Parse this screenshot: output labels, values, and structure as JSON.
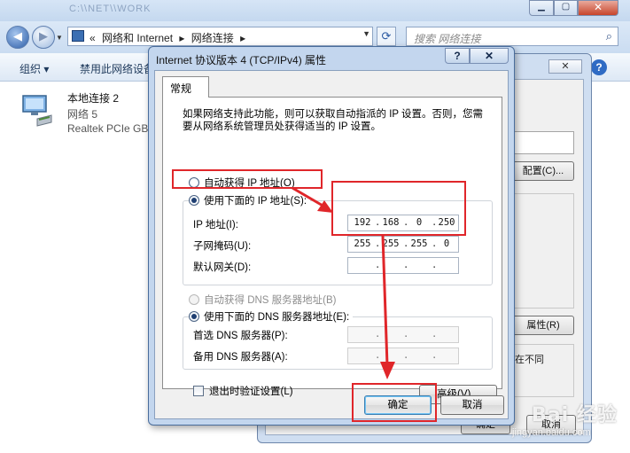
{
  "explorer": {
    "blurred_title": "C:\\\\NET\\\\WORK",
    "address": {
      "prefix": "«",
      "crumbs": [
        "网络和 Internet",
        "网络连接"
      ],
      "separator": "▸"
    },
    "search_placeholder": "搜索 网络连接",
    "commands": {
      "organize": "组织 ▾",
      "disable": "禁用此网络设备"
    },
    "connection": {
      "name": "本地连接 2",
      "network": "网络  5",
      "device": "Realtek PCIe GBE"
    }
  },
  "prop_dialog": {
    "configure_btn": "配置(C)...",
    "properties_btn": "属性(R)",
    "desc_tail": "在不同",
    "ok": "确定",
    "cancel": "取消"
  },
  "dialog": {
    "title": "Internet 协议版本 4 (TCP/IPv4) 属性",
    "help": "?",
    "close": "✕",
    "tab": "常规",
    "description": "如果网络支持此功能，则可以获取自动指派的 IP 设置。否则，您需要从网络系统管理员处获得适当的 IP 设置。",
    "ip_section": {
      "auto_label": "自动获得 IP 地址(O)",
      "auto_selected": false,
      "manual_label": "使用下面的 IP 地址(S):",
      "manual_selected": true,
      "ip_label": "IP 地址(I):",
      "ip": [
        "192",
        "168",
        "0",
        "250"
      ],
      "mask_label": "子网掩码(U):",
      "mask": [
        "255",
        "255",
        "255",
        "0"
      ],
      "gateway_label": "默认网关(D):",
      "gateway": [
        "",
        "",
        "",
        ""
      ]
    },
    "dns_section": {
      "auto_label": "自动获得 DNS 服务器地址(B)",
      "auto_selected": false,
      "manual_label": "使用下面的 DNS 服务器地址(E):",
      "manual_selected": true,
      "preferred_label": "首选 DNS 服务器(P):",
      "preferred": [
        "",
        "",
        "",
        ""
      ],
      "alternate_label": "备用 DNS 服务器(A):",
      "alternate": [
        "",
        "",
        "",
        ""
      ]
    },
    "validate_label": "退出时验证设置(L)",
    "validate_checked": false,
    "advanced_btn": "高级(V)...",
    "ok_btn": "确定",
    "cancel_btn": "取消"
  },
  "watermark": {
    "brand": "Bai 经验",
    "url": "jingyan.baidu.com"
  },
  "colors": {
    "annotation": "#e0262a",
    "titlebar": "#c3d6ee",
    "window": "#f0f0f0"
  }
}
